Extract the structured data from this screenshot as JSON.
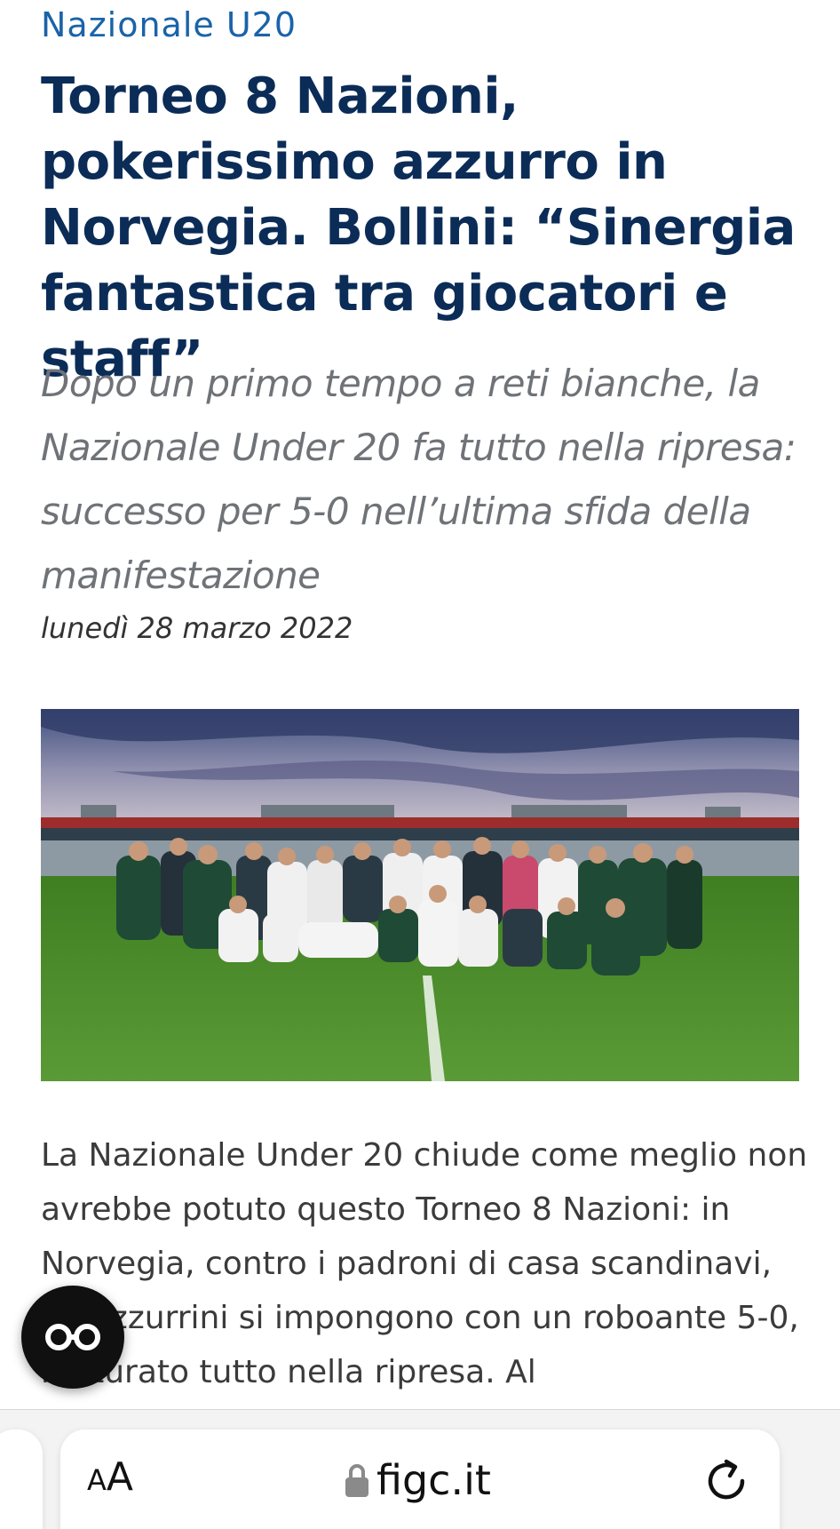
{
  "article": {
    "category": "Nazionale U20",
    "headline": "Torneo 8 Nazioni, pokerissimo azzurro in Norvegia. Bollini: “Sinergia fantastica tra giocatori e staff”",
    "subheadline": "Dopo un primo tempo a reti bianche, la Nazionale Under 20 fa tutto nella ripresa: successo per 5-0 nell’ultima sfida della manifestazione",
    "date": "lunedì 28 marzo 2022",
    "body": "La Nazionale Under 20 chiude come meglio non avrebbe potuto questo Torneo 8 Nazioni: in Norvegia, contro i padroni di casa scandinavi, gli Azzurrini si impongono con un roboante 5-0, maturato tutto nella ripresa. Al"
  },
  "photo": {
    "colors": {
      "sky_top": "#4a5a86",
      "sky_bottom": "#c9c3cf",
      "pitch": "#4c8a2c",
      "team_kit": "#f2f2f2",
      "staff_kit": "#1f4a35"
    }
  },
  "reader_button": {
    "icon": "reader-glasses-icon"
  },
  "browser": {
    "text_size_small": "A",
    "text_size_big": "A",
    "url": "figc.it",
    "lock_icon": "lock-icon",
    "reload_icon": "reload-icon"
  }
}
